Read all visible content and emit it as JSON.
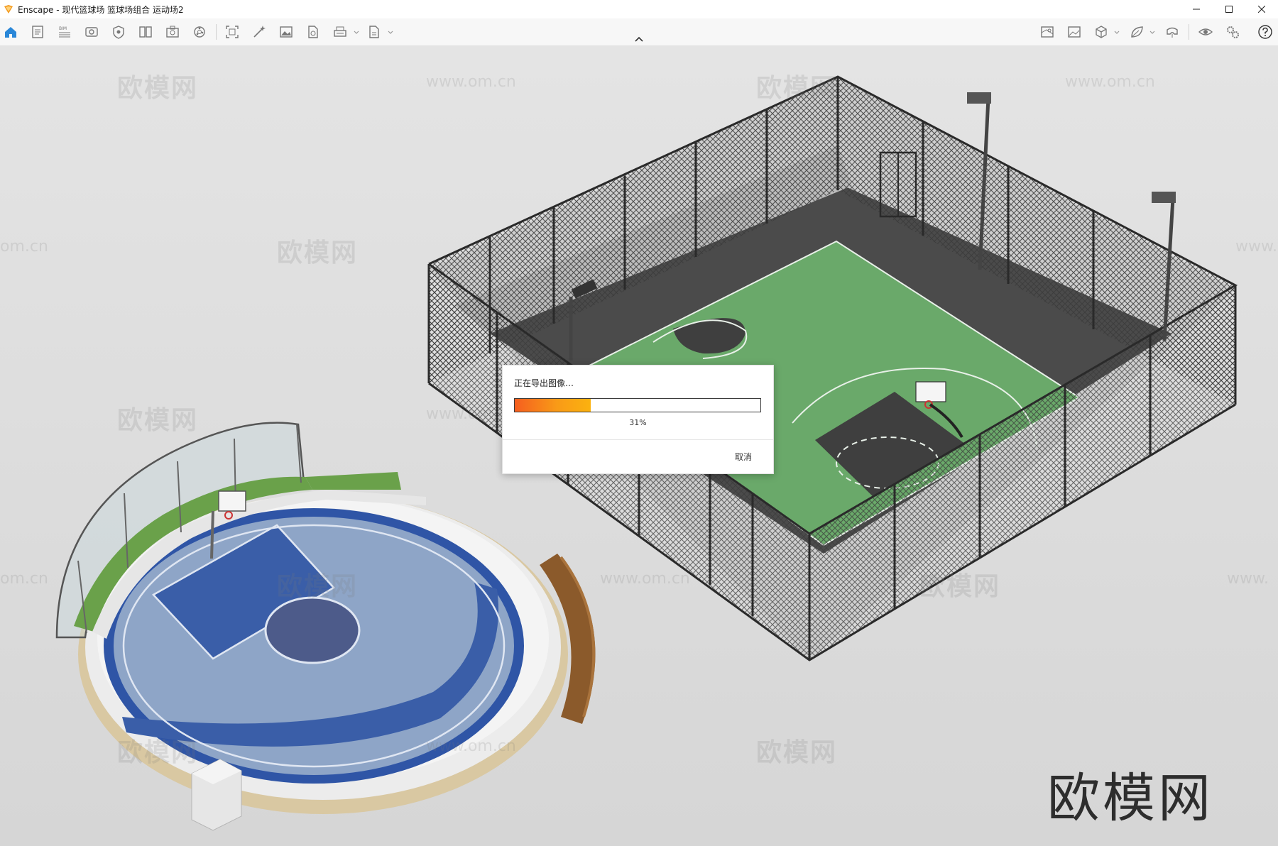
{
  "window": {
    "title": "Enscape - 现代篮球场 篮球场组合 运动场2",
    "controls": [
      "minimize",
      "maximize",
      "close"
    ]
  },
  "toolbar": {
    "left_icons": [
      "home-icon",
      "file-icon",
      "bim-icon",
      "views-icon",
      "visual-settings-icon",
      "materials-icon",
      "asset-library-icon",
      "sun-icon",
      "capture-icon",
      "magic-wand-icon",
      "render-image-icon",
      "batch-render-icon",
      "export-icon",
      "web-export-icon"
    ],
    "right_icons": [
      "map-icon",
      "image-panel-icon",
      "cube-icon",
      "leaf-icon",
      "vr-headset-icon",
      "eye-icon",
      "gears-icon",
      "help-icon"
    ],
    "bim_label": "BIM"
  },
  "dialog": {
    "message": "正在导出图像…",
    "progress": 0.31,
    "progress_text": "31%",
    "cancel_label": "取消"
  },
  "watermarks": {
    "cn": "欧模网",
    "url": "www.om.cn",
    "url_partial_left": "om.cn",
    "url_partial_right": "www."
  },
  "brand": "欧模网",
  "colors": {
    "progress_start": "#f55e1f",
    "progress_end": "#fbb20f",
    "court_green": "#6aa96a",
    "court_blue": "#3a5ea8",
    "court_light_blue": "#8aa2c4",
    "background": "#dcdcdc",
    "accent": "#2a87d8"
  }
}
